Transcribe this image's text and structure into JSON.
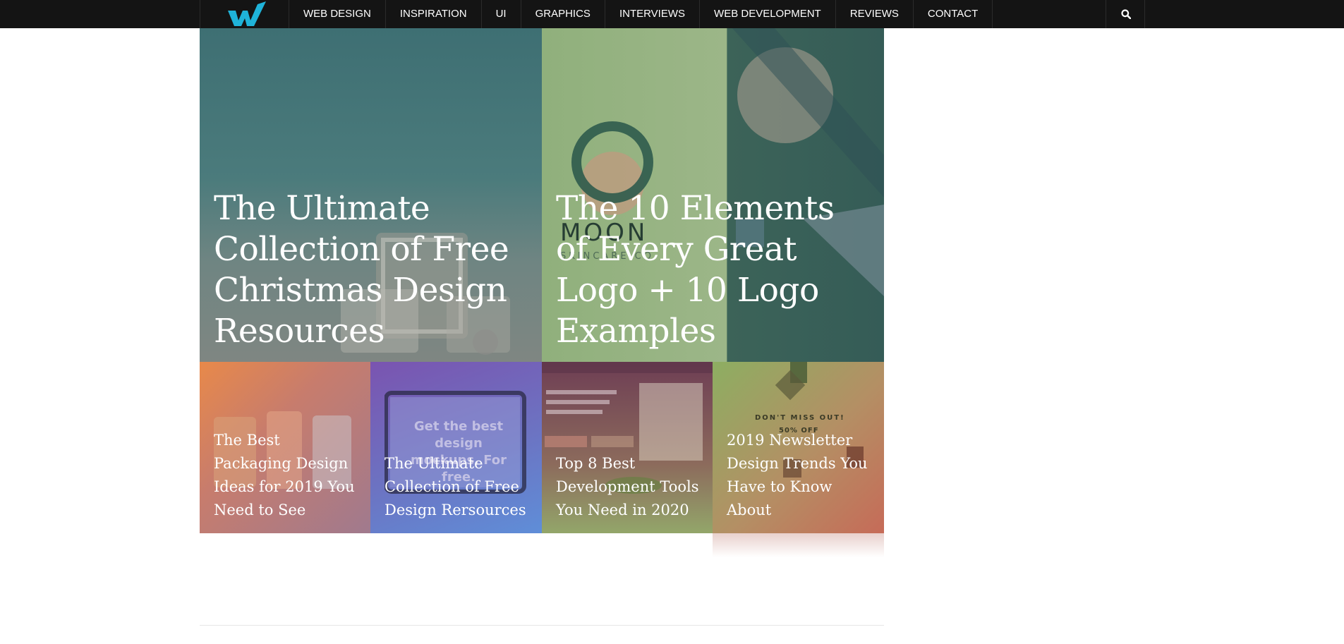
{
  "nav": {
    "items": [
      {
        "label": "WEB DESIGN"
      },
      {
        "label": "INSPIRATION"
      },
      {
        "label": "UI"
      },
      {
        "label": "GRAPHICS"
      },
      {
        "label": "INTERVIEWS"
      },
      {
        "label": "WEB DEVELOPMENT"
      },
      {
        "label": "REVIEWS"
      },
      {
        "label": "CONTACT"
      }
    ],
    "logo_icon": "w-logo-icon",
    "search_icon": "search-icon",
    "logo_color": "#1fb3d9"
  },
  "featured": [
    {
      "title": "The Ultimate Collection of Free Christmas Design Resources"
    },
    {
      "title": "The 10 Elements of Every Great Logo + 10 Logo Examples"
    }
  ],
  "posts": [
    {
      "title": "The Best Packaging Design Ideas for 2019 You Need to See"
    },
    {
      "title": "The Ultimate Collection of Free Design Rersources"
    },
    {
      "title": "Top 8 Best Development Tools You Need in 2020"
    },
    {
      "title": "2019 Newsletter Design Trends You Have to Know About"
    }
  ],
  "image_text": {
    "moon": "MOON",
    "moon_sub": "SKINCARE CO",
    "mockups": "Get the best design mockups. For free.",
    "newsletter_dont_miss": "DON'T MISS OUT!",
    "newsletter_off": "50% OFF"
  }
}
